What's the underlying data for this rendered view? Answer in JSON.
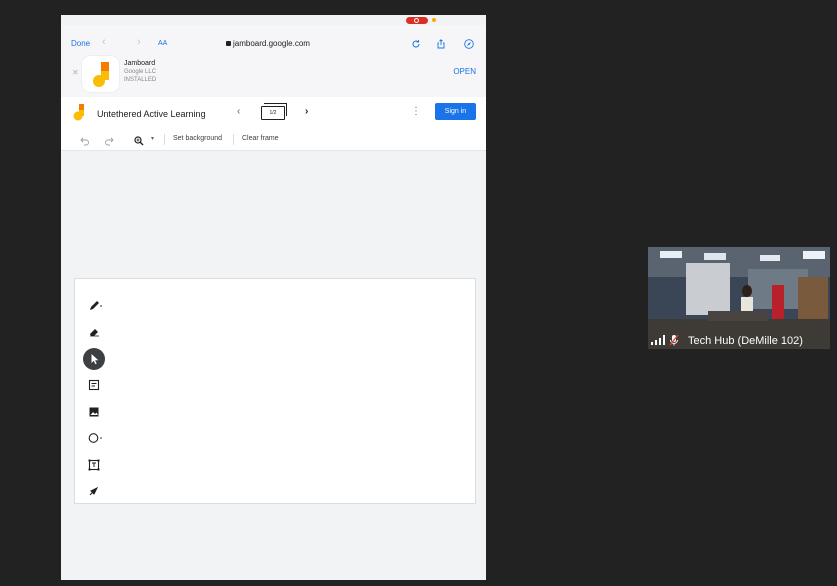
{
  "browser": {
    "done_label": "Done",
    "text_size_label": "AA",
    "url": "jamboard.google.com"
  },
  "app_banner": {
    "app_name": "Jamboard",
    "publisher": "Google LLC",
    "status": "INSTALLED",
    "open_label": "OPEN"
  },
  "jamboard": {
    "title": "Untethered Active Learning",
    "frame_indicator": "1/2",
    "sign_in_label": "Sign in",
    "set_background_label": "Set background",
    "clear_frame_label": "Clear frame",
    "tools": [
      "pen-icon",
      "eraser-icon",
      "select-icon",
      "sticky-note-icon",
      "image-icon",
      "circle-icon",
      "text-box-icon",
      "laser-icon"
    ],
    "selected_tool": "select-icon"
  },
  "video_tile": {
    "participant_name": "Tech Hub (DeMille 102)"
  },
  "colors": {
    "accent": "#1a73e8",
    "background": "#222222",
    "record": "#d93025"
  }
}
